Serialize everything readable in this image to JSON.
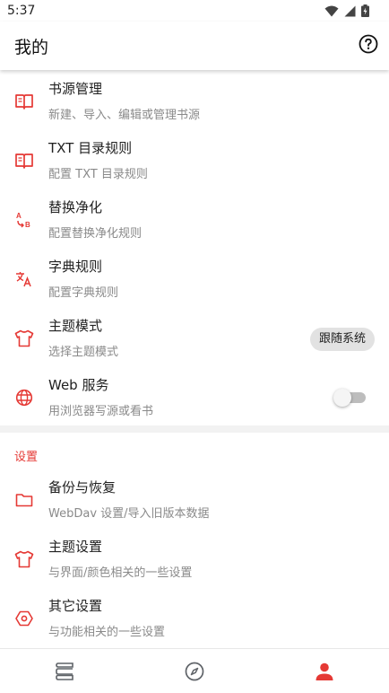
{
  "status_bar": {
    "time": "5:37",
    "icons": [
      "wifi-icon",
      "signal-icon",
      "battery-icon"
    ]
  },
  "app_bar": {
    "title": "我的",
    "help_icon": "help-circle-icon"
  },
  "items": [
    {
      "id": "book-source",
      "title": "书源管理",
      "summary": "新建、导入、编辑或管理书源",
      "icon": "book-icon"
    },
    {
      "id": "txt-toc-rules",
      "title": "TXT 目录规则",
      "summary": "配置 TXT 目录规则",
      "icon": "book-icon"
    },
    {
      "id": "replace-purify",
      "title": "替换净化",
      "summary": "配置替换净化规则",
      "icon": "replace-ab-icon"
    },
    {
      "id": "dict-rules",
      "title": "字典规则",
      "summary": "配置字典规则",
      "icon": "translate-icon"
    },
    {
      "id": "theme-mode",
      "title": "主题模式",
      "summary": "选择主题模式",
      "icon": "shirt-icon",
      "value": "跟随系统"
    },
    {
      "id": "web-service",
      "title": "Web 服务",
      "summary": "用浏览器写源或看书",
      "icon": "globe-icon",
      "enabled": false
    }
  ],
  "settings_section": {
    "header": "设置",
    "items": [
      {
        "id": "backup-restore",
        "title": "备份与恢复",
        "summary": "WebDav 设置/导入旧版本数据",
        "icon": "folder-icon"
      },
      {
        "id": "theme-settings",
        "title": "主题设置",
        "summary": "与界面/颜色相关的一些设置",
        "icon": "shirt-icon"
      },
      {
        "id": "other-settings",
        "title": "其它设置",
        "summary": "与功能相关的一些设置",
        "icon": "hexagon-icon"
      }
    ]
  },
  "bottom_nav": [
    {
      "id": "bookshelf",
      "icon": "bookshelf-icon",
      "active": false
    },
    {
      "id": "explore",
      "icon": "compass-icon",
      "active": false
    },
    {
      "id": "my",
      "icon": "person-icon",
      "active": true
    }
  ],
  "colors": {
    "accent": "#e53935",
    "text_primary": "#212121",
    "text_secondary": "#8a8a8a",
    "inactive_icon": "#5f6368"
  }
}
